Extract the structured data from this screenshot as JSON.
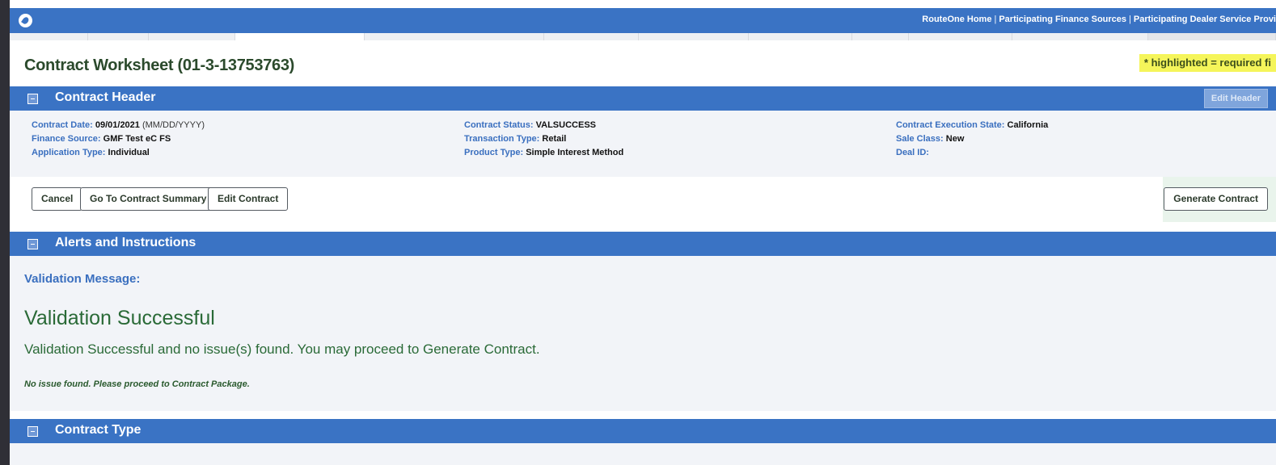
{
  "topbar": {
    "links": [
      "RouteOne Home",
      "Participating Finance Sources",
      "Participating Dealer Service Provi"
    ],
    "separator": "|"
  },
  "page": {
    "title": "Contract Worksheet (01-3-13753763)",
    "required_note": "* highlighted = required fi"
  },
  "contract_header": {
    "title": "Contract Header",
    "edit_header_label": "Edit Header",
    "fields": {
      "contract_date": {
        "label": "Contract Date:",
        "value": "09/01/2021",
        "format": "(MM/DD/YYYY)"
      },
      "finance_source": {
        "label": "Finance Source:",
        "value": "GMF Test eC FS"
      },
      "application_type": {
        "label": "Application Type:",
        "value": "Individual"
      },
      "contract_status": {
        "label": "Contract Status:",
        "value": "VALSUCCESS"
      },
      "transaction_type": {
        "label": "Transaction Type:",
        "value": "Retail"
      },
      "product_type": {
        "label": "Product Type:",
        "value": "Simple Interest Method"
      },
      "execution_state": {
        "label": "Contract Execution State:",
        "value": "California"
      },
      "sale_class": {
        "label": "Sale Class:",
        "value": "New"
      },
      "deal_id": {
        "label": "Deal ID:",
        "value": ""
      }
    },
    "buttons": {
      "cancel": "Cancel",
      "go_to_summary": "Go To Contract Summary",
      "edit_contract": "Edit Contract",
      "generate_contract": "Generate Contract"
    }
  },
  "alerts": {
    "title": "Alerts and Instructions",
    "validation_label": "Validation Message:",
    "validation_heading": "Validation Successful",
    "validation_text": "Validation Successful and no issue(s) found. You may proceed to Generate Contract.",
    "note": "No issue found. Please proceed to Contract Package."
  },
  "contract_type": {
    "title": "Contract Type"
  },
  "colors": {
    "header_blue": "#3a73c4",
    "title_green": "#2b4a2c",
    "success_green": "#2a6a37",
    "label_blue": "#3a6fbf",
    "highlight_yellow": "#f5f55a"
  }
}
